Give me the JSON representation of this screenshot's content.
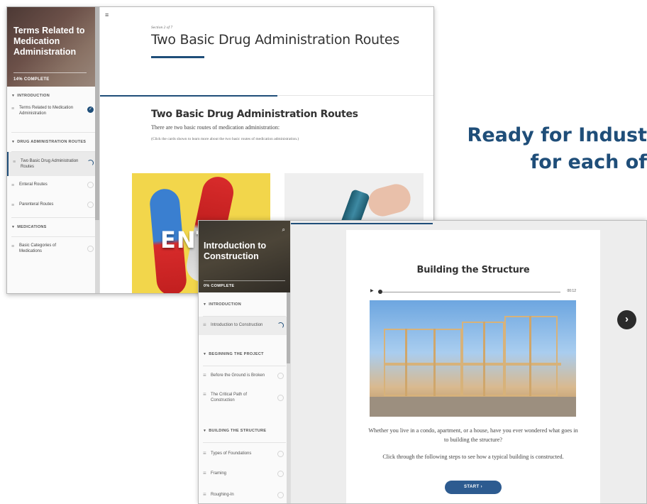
{
  "promo": {
    "line1": "Ready for Indust",
    "line2": "for each of"
  },
  "window1": {
    "course_title": "Terms Related to Medication Administration",
    "progress": "14% COMPLETE",
    "sections": [
      {
        "heading": "INTRODUCTION",
        "lessons": [
          {
            "label": "Terms Related to Medication Administration",
            "status": "complete"
          }
        ]
      },
      {
        "heading": "DRUG ADMINISTRATION ROUTES",
        "lessons": [
          {
            "label": "Two Basic Drug Administration Routes",
            "status": "in-progress"
          },
          {
            "label": "Enteral Routes",
            "status": "not-started"
          },
          {
            "label": "Parenteral Routes",
            "status": "not-started"
          }
        ]
      },
      {
        "heading": "MEDICATIONS",
        "lessons": [
          {
            "label": "Basic Categories of Medications",
            "status": "not-started"
          }
        ]
      }
    ],
    "menu_icon": "hamburger-icon",
    "section_label": "Section 2 of 7",
    "lesson_title": "Two Basic Drug Administration Routes",
    "content_heading": "Two Basic Drug Administration Routes",
    "content_text": "There are two basic routes of medication administration:",
    "content_note": "(Click the cards shown to learn more about the two basic routes of medication administration.)",
    "card1_label": "ENT",
    "progress_fraction": 0.14
  },
  "window2": {
    "course_title": "Introduction to Construction",
    "progress": "0% COMPLETE",
    "search_icon": "search-icon",
    "sections": [
      {
        "heading": "INTRODUCTION",
        "lessons": [
          {
            "label": "Introduction to Construction",
            "status": "in-progress"
          }
        ]
      },
      {
        "heading": "BEGINNING THE PROJECT",
        "lessons": [
          {
            "label": "Before the Ground is Broken",
            "status": "not-started"
          },
          {
            "label": "The Critical Path of Construction",
            "status": "not-started"
          }
        ]
      },
      {
        "heading": "BUILDING THE STRUCTURE",
        "lessons": [
          {
            "label": "Types of Foundations",
            "status": "not-started"
          },
          {
            "label": "Framing",
            "status": "not-started"
          },
          {
            "label": "Roughing-In",
            "status": "not-started"
          }
        ]
      }
    ],
    "lesson_heading": "Building the Structure",
    "audio_time": "00:12",
    "paragraph1": "Whether you live in a condo, apartment, or a house, have you ever wondered what goes in to building the structure?",
    "paragraph2": "Click through the following steps to see how a typical building is constructed.",
    "start_button": "START ›",
    "next_icon": "chevron-right-icon",
    "next_glyph": "›"
  },
  "colors": {
    "accent": "#1f4e79",
    "button": "#2d5b90",
    "card_yellow": "#f2d64b"
  }
}
